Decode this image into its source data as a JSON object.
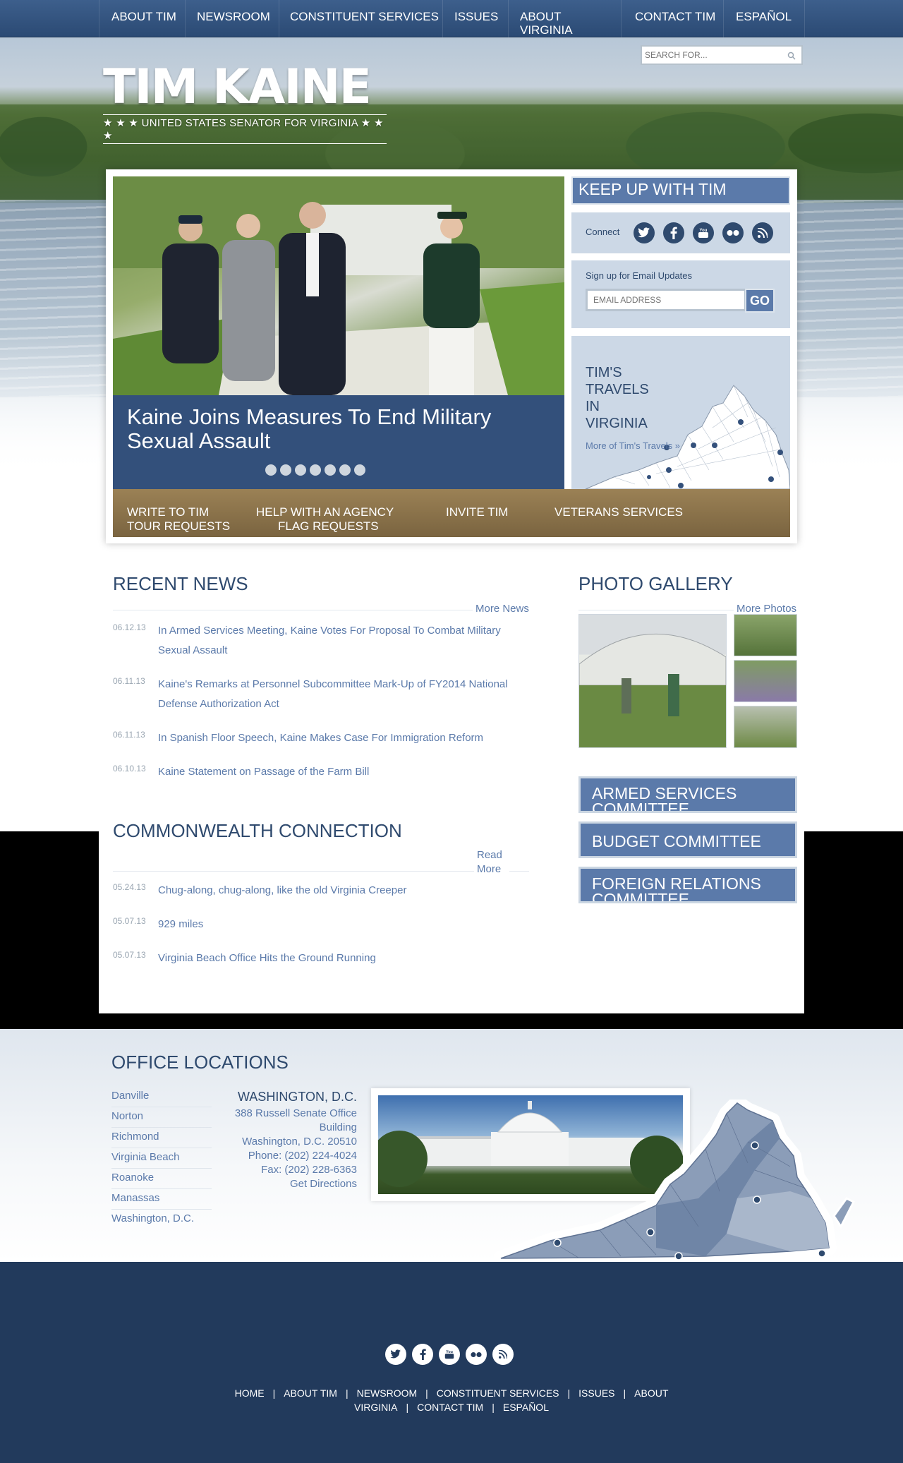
{
  "nav": {
    "items": [
      "ABOUT TIM",
      "NEWSROOM",
      "CONSTITUENT SERVICES",
      "ISSUES",
      "ABOUT VIRGINIA",
      "CONTACT TIM",
      "ESPAÑOL"
    ]
  },
  "search": {
    "placeholder": "SEARCH FOR..."
  },
  "header": {
    "name": "TIM KAINE",
    "tagline": "★ ★ ★ UNITED STATES SENATOR FOR VIRGINIA ★ ★ ★"
  },
  "slideshow": {
    "caption": "Kaine Joins Measures To End Military Sexual Assault",
    "slide_count": 7
  },
  "sidebar": {
    "keep_up": "KEEP UP WITH TIM",
    "connect_label": "Connect",
    "social_icons": [
      "twitter-icon",
      "facebook-icon",
      "youtube-icon",
      "flickr-icon",
      "rss-icon"
    ],
    "email_label": "Sign up for Email Updates",
    "email_placeholder": "EMAIL ADDRESS",
    "go_label": "GO",
    "travels_title": "TIM'S TRAVELS IN VIRGINIA",
    "travels_link": "More of Tim's Travels »"
  },
  "quicklinks": {
    "write": "WRITE TO TIM",
    "help": "HELP WITH AN AGENCY",
    "invite": "INVITE TIM",
    "veterans": "VETERANS SERVICES",
    "tour": "TOUR REQUESTS",
    "flag": "FLAG REQUESTS"
  },
  "recent_news": {
    "title": "RECENT NEWS",
    "more": "More News",
    "items": [
      {
        "date": "06.12.13",
        "text": "In Armed Services Meeting, Kaine Votes For Proposal To Combat Military Sexual Assault"
      },
      {
        "date": "06.11.13",
        "text": "Kaine's Remarks at Personnel Subcommittee Mark-Up of FY2014 National Defense Authorization Act"
      },
      {
        "date": "06.11.13",
        "text": "In Spanish Floor Speech, Kaine Makes Case For Immigration Reform"
      },
      {
        "date": "06.10.13",
        "text": "Kaine Statement on Passage of the Farm Bill"
      }
    ]
  },
  "commonwealth": {
    "title": "COMMONWEALTH CONNECTION",
    "more": "Read More",
    "items": [
      {
        "date": "05.24.13",
        "text": "Chug-along, chug-along, like the old Virginia Creeper"
      },
      {
        "date": "05.07.13",
        "text": "929 miles"
      },
      {
        "date": "05.07.13",
        "text": "Virginia Beach Office Hits the Ground Running"
      }
    ]
  },
  "gallery": {
    "title": "PHOTO GALLERY",
    "more": "More Photos"
  },
  "committees": [
    "ARMED SERVICES COMMITTEE",
    "BUDGET COMMITTEE",
    "FOREIGN RELATIONS COMMITTEE"
  ],
  "offices": {
    "title": "OFFICE LOCATIONS",
    "list": [
      "Danville",
      "Norton",
      "Richmond",
      "Virginia Beach",
      "Roanoke",
      "Manassas",
      "Washington, D.C."
    ],
    "city": "WASHINGTON, D.C.",
    "address1": "388 Russell Senate Office Building",
    "address2": "Washington, D.C. 20510",
    "phone": "Phone: (202) 224-4024",
    "fax": "Fax: (202) 228-6363",
    "directions": "Get Directions"
  },
  "footer": {
    "links": [
      "HOME",
      "ABOUT TIM",
      "NEWSROOM",
      "CONSTITUENT SERVICES",
      "ISSUES",
      "ABOUT VIRGINIA",
      "CONTACT TIM",
      "ESPAÑOL"
    ]
  },
  "colors": {
    "navy": "#223a5c",
    "accent_blue": "#5b7aaa",
    "caption_blue": "#33507b",
    "gold_bar": "#8a714a",
    "panel_blue": "#ccd8e6"
  }
}
